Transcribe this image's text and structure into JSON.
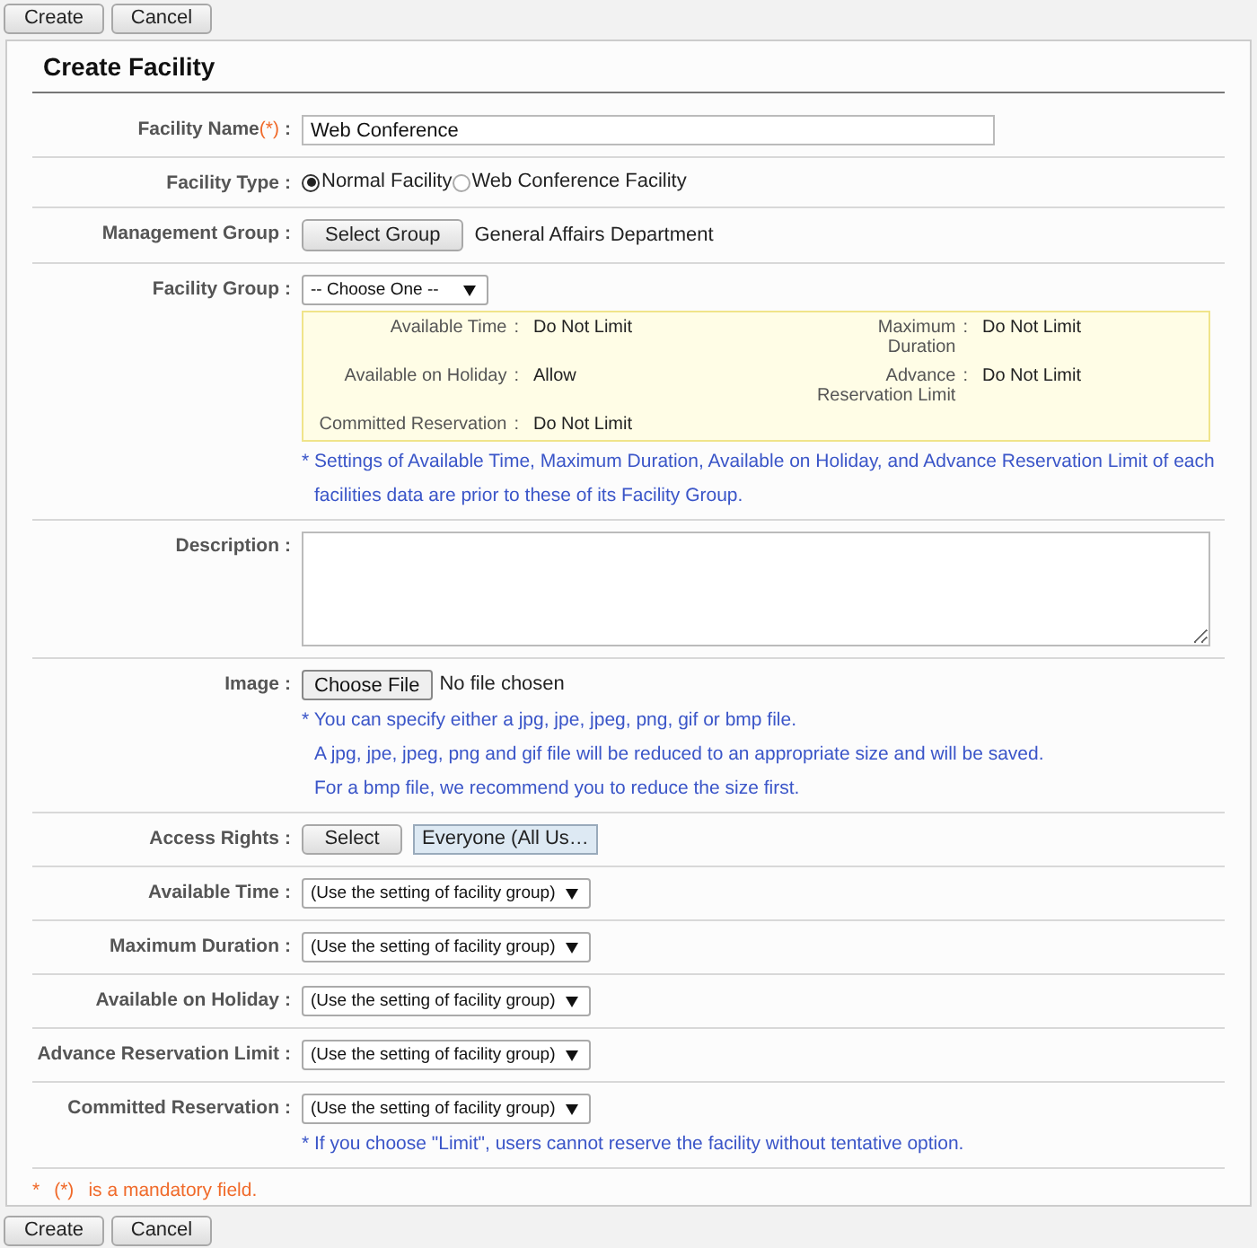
{
  "top_buttons": [
    "Create",
    "Cancel"
  ],
  "title": "Create Facility",
  "fields": [
    {
      "kind": "text",
      "label": "Facility Name",
      "required_mark": "(*)",
      "colon": ":",
      "value": "Web Conference"
    },
    {
      "kind": "radio",
      "label": "Facility Type",
      "colon": ":",
      "options": [
        {
          "label": "Normal Facility",
          "selected": true
        },
        {
          "label": "Web Conference Facility",
          "selected": false
        }
      ]
    },
    {
      "kind": "group_picker",
      "label": "Management Group",
      "colon": ":",
      "button": "Select Group",
      "value": "General Affairs Department"
    },
    {
      "kind": "group_select",
      "label": "Facility Group",
      "colon": ":",
      "value": "-- Choose One --",
      "settings": [
        {
          "label": "Available Time",
          "colon": ":",
          "value": "Do Not Limit"
        },
        {
          "label": "Maximum Duration",
          "colon": ":",
          "value": "Do Not Limit"
        },
        {
          "label": "Available on Holiday",
          "colon": ":",
          "value": "Allow"
        },
        {
          "label": "Advance Reservation Limit",
          "colon": ":",
          "value": "Do Not Limit"
        },
        {
          "label": "Committed Reservation",
          "colon": ":",
          "value": "Do Not Limit"
        }
      ],
      "notes": [
        "* Settings of Available Time, Maximum Duration, Available on Holiday, and Advance Reservation Limit of each",
        "facilities data are prior to these of its Facility Group."
      ]
    },
    {
      "kind": "textarea",
      "label": "Description",
      "colon": ":"
    },
    {
      "kind": "file",
      "label": "Image",
      "colon": ":",
      "button": "Choose File",
      "status": "No file chosen",
      "notes": [
        "* You can specify either a jpg, jpe, jpeg, png, gif or bmp file.",
        "A jpg, jpe, jpeg, png and gif file will be reduced to an appropriate size and will be saved.",
        "For a bmp file, we recommend you to reduce the size first."
      ]
    },
    {
      "kind": "access",
      "label": "Access Rights",
      "colon": ":",
      "button": "Select",
      "value": "Everyone (All Us…"
    },
    {
      "kind": "select",
      "label": "Available Time",
      "colon": ":",
      "value": "(Use the setting of facility group)"
    },
    {
      "kind": "select",
      "label": "Maximum Duration",
      "colon": ":",
      "value": "(Use the setting of facility group)"
    },
    {
      "kind": "select",
      "label": "Available on Holiday",
      "colon": ":",
      "value": "(Use the setting of facility group)"
    },
    {
      "kind": "select",
      "label": "Advance Reservation Limit",
      "colon": ":",
      "value": "(Use the setting of facility group)"
    },
    {
      "kind": "select",
      "label": "Committed Reservation",
      "colon": ":",
      "value": "(Use the setting of facility group)",
      "notes": [
        "* If you choose \"Limit\", users cannot reserve the facility without tentative option."
      ]
    }
  ],
  "mandatory_note": {
    "star": "*",
    "mark": "(*)",
    "text": "is a mandatory field."
  },
  "bottom_buttons": [
    "Create",
    "Cancel"
  ]
}
